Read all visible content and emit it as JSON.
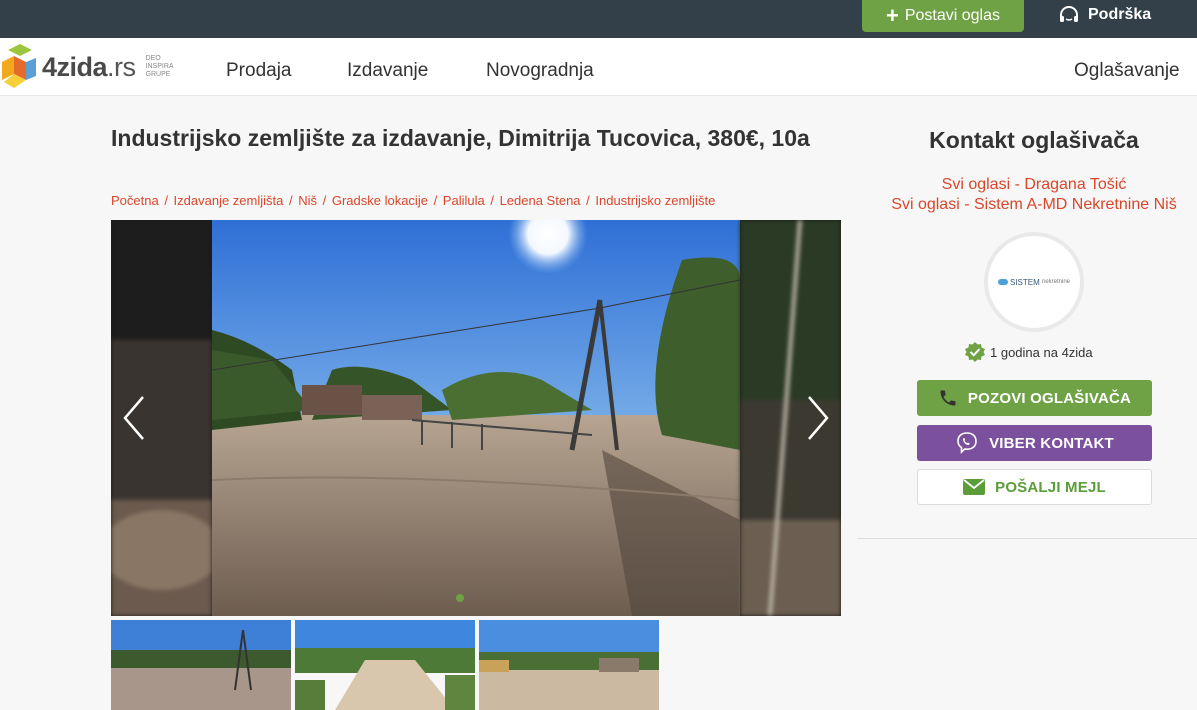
{
  "topbar": {
    "post_label": "Postavi oglas",
    "support_label": "Podrška"
  },
  "header": {
    "logo_text": "4zida",
    "logo_tld": ".rs",
    "logo_sub": "DEO INSPIRA GRUPE",
    "nav": [
      "Prodaja",
      "Izdavanje",
      "Novogradnja"
    ],
    "nav_right": "Oglašavanje"
  },
  "listing": {
    "title": "Industrijsko zemljište za izdavanje, Dimitrija Tucovica, 380€, 10a",
    "breadcrumbs": [
      "Početna",
      "Izdavanje zemljišta",
      "Niš",
      "Gradske lokacije",
      "Palilula",
      "Ledena Stena",
      "Industrijsko zemljište"
    ]
  },
  "gallery": {
    "prev_icon": "chevron-left-icon",
    "next_icon": "chevron-right-icon",
    "active_index": 0
  },
  "contact": {
    "title": "Kontakt oglašivača",
    "agent_links": [
      "Svi oglasi - Dragana Tošić",
      "Svi oglasi - Sistem A-MD Nekretnine Niš"
    ],
    "agency_logo_text": "SISTEM",
    "agency_logo_sub": "nekretnine",
    "member_since": "1 godina na 4zida",
    "call_label": "POZOVI OGLAŠIVAČA",
    "viber_label": "VIBER KONTAKT",
    "mail_label": "POŠALJI MEJL",
    "colors": {
      "green": "#6fa245",
      "viber": "#7b519d",
      "link": "#d9472b",
      "topbar": "#334049"
    }
  }
}
